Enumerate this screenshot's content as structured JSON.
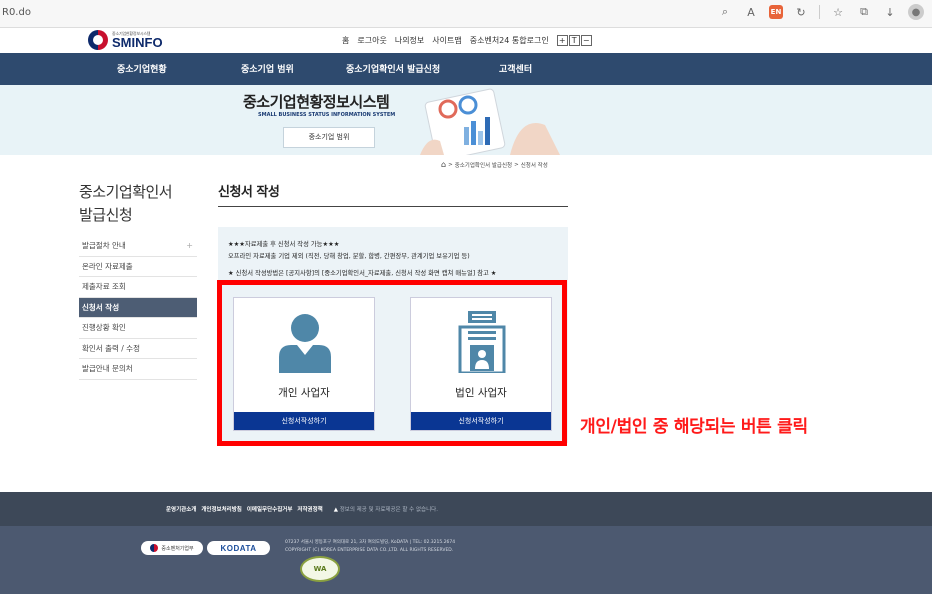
{
  "browser": {
    "url_fragment": "R0.do",
    "ext_label": "EN"
  },
  "header": {
    "logo_sub": "중소기업현황정보시스템",
    "logo_main": "SMINFO",
    "util_links": [
      "홈",
      "로그아웃",
      "나의정보",
      "사이트맵",
      "중소벤처24 통합로그인"
    ],
    "font_controls": [
      "+",
      "T",
      "−"
    ]
  },
  "nav": {
    "items": [
      "중소기업현황",
      "중소기업 범위",
      "중소기업확인서 발급신청",
      "고객센터"
    ]
  },
  "banner": {
    "title": "중소기업현황정보시스템",
    "subtitle": "SMALL BUSINESS STATUS INFORMATION SYSTEM",
    "button_label": "중소기업 범위"
  },
  "breadcrumb": {
    "items": [
      "중소기업확인서 발급신청",
      "신청서 작성"
    ]
  },
  "sidebar": {
    "title_line1": "중소기업확인서",
    "title_line2": "발급신청",
    "items": [
      {
        "label": "발급절차 안내",
        "active": false
      },
      {
        "label": "온라인 자료제출",
        "active": false
      },
      {
        "label": "제출자료 조회",
        "active": false
      },
      {
        "label": "신청서 작성",
        "active": true
      },
      {
        "label": "진행상황 확인",
        "active": false
      },
      {
        "label": "확인서 출력 / 수정",
        "active": false
      },
      {
        "label": "발급안내 문의처",
        "active": false
      }
    ],
    "plus": "+"
  },
  "content": {
    "title": "신청서 작성",
    "notice_lines": [
      "★★★자료제출 후 신청서 작성 가능★★★",
      "오프라인 자료제출 기업 제외 (직전, 당해 창업, 분할, 합병, 간편장부, 관계기업 보유기업 등)",
      "★ 신청서 작성방법은 [공지사항]의 [중소기업확인서_자료제출, 신청서 작성 화면 캡쳐 매뉴얼] 참고 ★"
    ],
    "cards": [
      {
        "label": "개인 사업자",
        "button": "신청서작성하기"
      },
      {
        "label": "법인 사업자",
        "button": "신청서작성하기"
      }
    ]
  },
  "instruction": "개인/법인 중 해당되는 버튼 클릭",
  "footer": {
    "links": [
      "운영기관소개",
      "개인정보처리방침",
      "이메일무단수집거부",
      "저작권정책"
    ],
    "notice": "정보의 제공 및 자료제공은 할 수 없습니다.",
    "logo1": "중소벤처기업부",
    "logo2": "KODATA",
    "address": "07237 서울시 영등포구 여의대로 21, 3차 여의도빌딩, KoDATA | TEL: 02.3215.2674",
    "copyright": "COPYRIGHT (C) KOREA ENTERPRISE DATA CO.,LTD. ALL RIGHTS RESERVED.",
    "badge": "WA"
  },
  "colors": {
    "nav_bg": "#2e4a6e",
    "banner_bg": "#e8f3f7",
    "active_side": "#4d5d74",
    "card_button": "#0a3693",
    "highlight_red": "#ff0000",
    "footer_top": "#3d4858",
    "footer_bottom": "#4c5970"
  }
}
